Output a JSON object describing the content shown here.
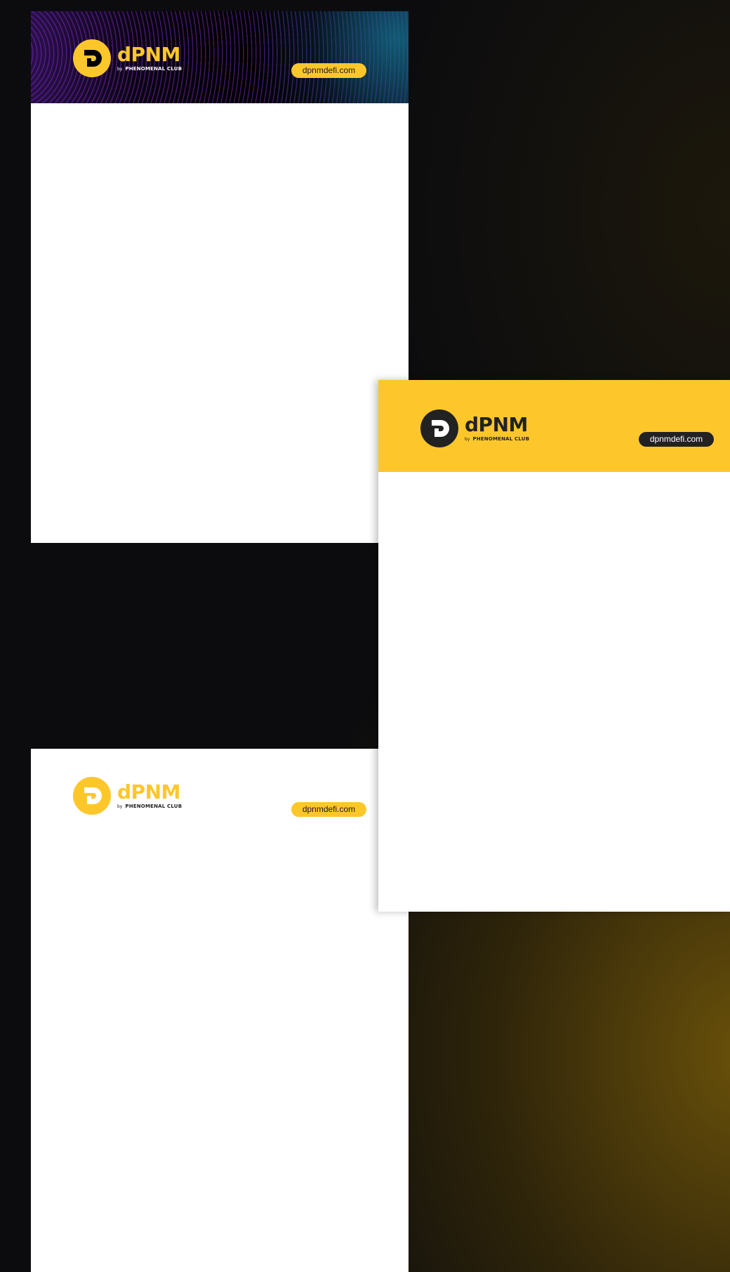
{
  "brand": {
    "name": "dPNM",
    "by": "by",
    "club": "PHENOMENAL CLUB",
    "url": "dpnmdefi.com"
  },
  "colors": {
    "brand_yellow": "#fdc72c",
    "dark": "#222222",
    "background": "#0c0c0e",
    "header_purple": "#2a0f4a",
    "header_teal": "#06202c"
  },
  "icons": {
    "logo_mark": "dpnm-logo-icon"
  },
  "cards": [
    {
      "variant": "dark-header"
    },
    {
      "variant": "yellow-header"
    },
    {
      "variant": "white-header"
    }
  ]
}
